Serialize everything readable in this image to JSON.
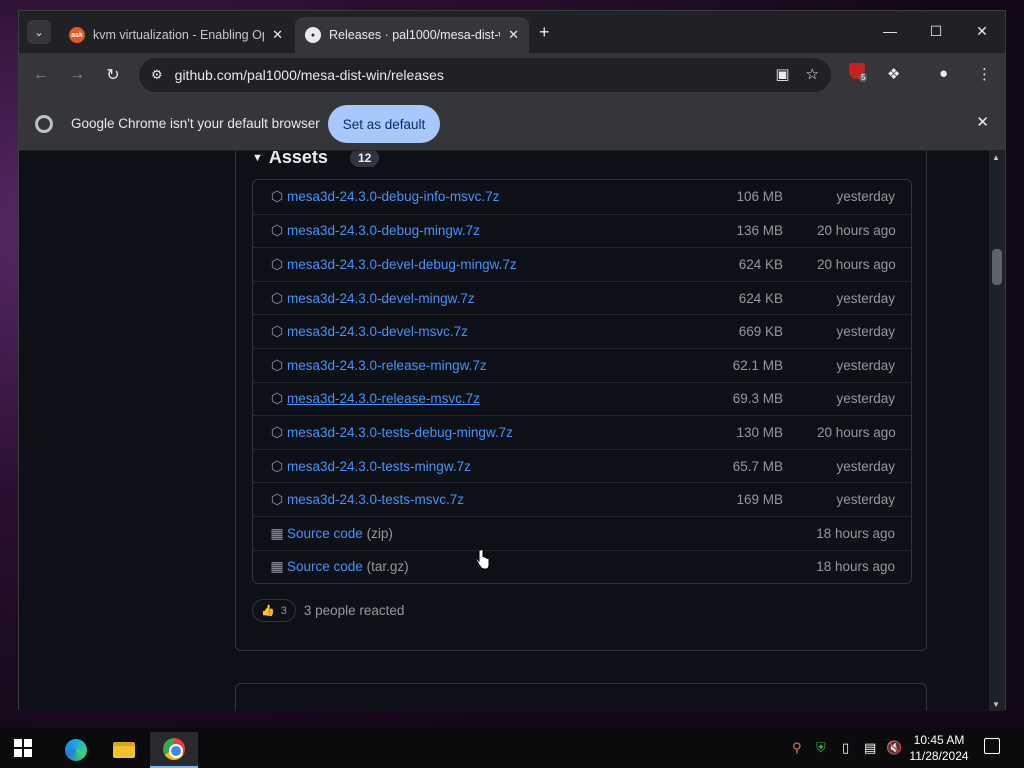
{
  "browser": {
    "tabs": [
      {
        "title": "kvm virtualization - Enabling Op",
        "favicon": "ask",
        "active": false
      },
      {
        "title": "Releases · pal1000/mesa-dist-w",
        "favicon": "gh",
        "active": true
      }
    ],
    "favicon_ask_text": "ask",
    "url": "github.com/pal1000/mesa-dist-win/releases",
    "extension_badge_count": "5",
    "infobar": {
      "message": "Google Chrome isn't your default browser",
      "button": "Set as default"
    }
  },
  "release": {
    "assets_label": "Assets",
    "assets_count": "12",
    "assets": [
      {
        "name": "mesa3d-24.3.0-debug-info-msvc.7z",
        "size": "106 MB",
        "date": "yesterday"
      },
      {
        "name": "mesa3d-24.3.0-debug-mingw.7z",
        "size": "136 MB",
        "date": "20 hours ago"
      },
      {
        "name": "mesa3d-24.3.0-devel-debug-mingw.7z",
        "size": "624 KB",
        "date": "20 hours ago"
      },
      {
        "name": "mesa3d-24.3.0-devel-mingw.7z",
        "size": "624 KB",
        "date": "yesterday"
      },
      {
        "name": "mesa3d-24.3.0-devel-msvc.7z",
        "size": "669 KB",
        "date": "yesterday"
      },
      {
        "name": "mesa3d-24.3.0-release-mingw.7z",
        "size": "62.1 MB",
        "date": "yesterday"
      },
      {
        "name": "mesa3d-24.3.0-release-msvc.7z",
        "size": "69.3 MB",
        "date": "yesterday"
      },
      {
        "name": "mesa3d-24.3.0-tests-debug-mingw.7z",
        "size": "130 MB",
        "date": "20 hours ago"
      },
      {
        "name": "mesa3d-24.3.0-tests-mingw.7z",
        "size": "65.7 MB",
        "date": "yesterday"
      },
      {
        "name": "mesa3d-24.3.0-tests-msvc.7z",
        "size": "169 MB",
        "date": "yesterday"
      }
    ],
    "source_assets": [
      {
        "label": "Source code",
        "ext": "(zip)",
        "date": "18 hours ago"
      },
      {
        "label": "Source code",
        "ext": "(tar.gz)",
        "date": "18 hours ago"
      }
    ],
    "reaction_count": "3",
    "reaction_text": "3 people reacted"
  },
  "taskbar": {
    "time": "10:45 AM",
    "date": "11/28/2024"
  },
  "colors": {
    "link": "#4493f8",
    "muted": "#9198a1",
    "page_bg": "#0d1117",
    "accent_button": "#a8c7fa"
  }
}
